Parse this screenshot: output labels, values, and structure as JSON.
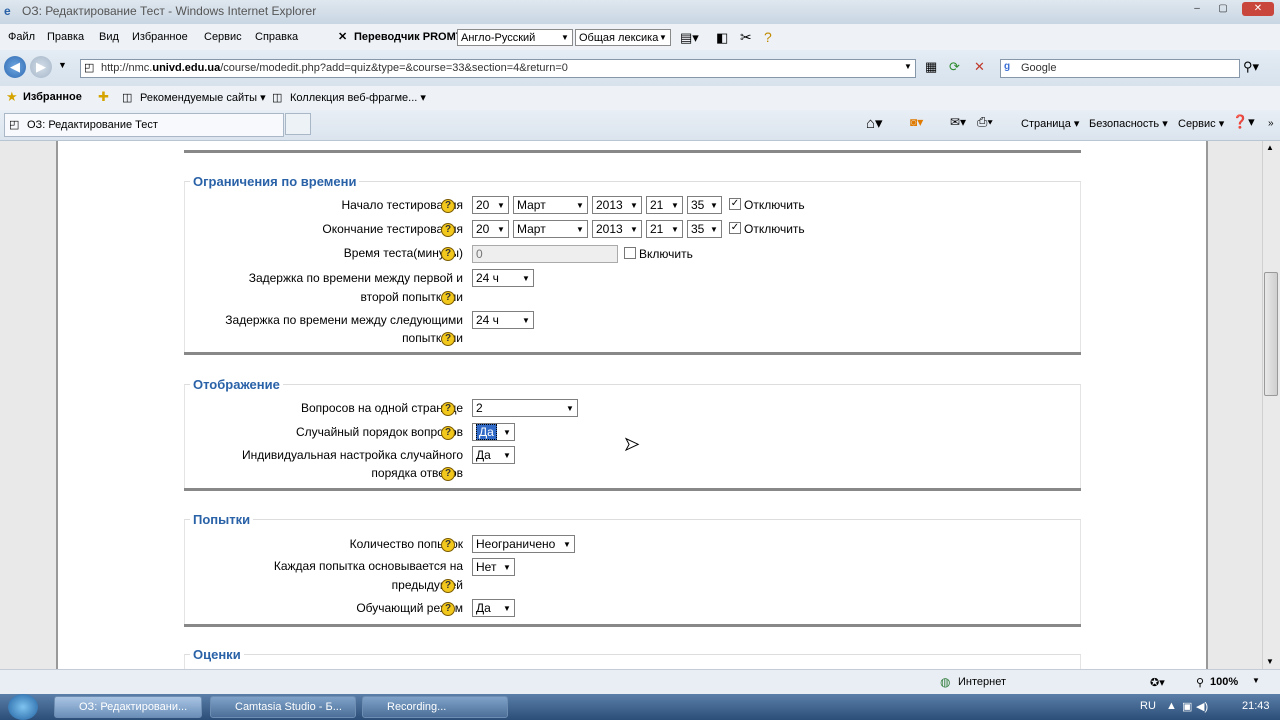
{
  "window": {
    "title": "ОЗ: Редактирование Тест - Windows Internet Explorer",
    "minimize": "‒",
    "maximize": "▢",
    "close": "✕"
  },
  "menubar": {
    "items": [
      "Файл",
      "Правка",
      "Вид",
      "Избранное",
      "Сервис",
      "Справка"
    ],
    "translator": "Переводчик PROMT",
    "direction": "Англо-Русский",
    "vocab": "Общая лексика"
  },
  "address": {
    "url_prefix": "http://nmc.",
    "url_domain": "univd.edu.ua",
    "url_path": "/course/modedit.php?add=quiz&type=&course=33&section=4&return=0",
    "search_placeholder": "Google"
  },
  "favorites": {
    "label": "Избранное",
    "items": [
      "Рекомендуемые сайты ▾",
      "Коллекция веб-фрагме... ▾"
    ]
  },
  "tab": {
    "title": "ОЗ: Редактирование Тест"
  },
  "commandbar": {
    "items": [
      "Страница ▾",
      "Безопасность ▾",
      "Сервис ▾"
    ]
  },
  "sections": {
    "time_limits": {
      "legend": "Ограничения по времени",
      "open_label": "Начало тестирования",
      "close_label": "Окончание тестирования",
      "open_date": {
        "day": "20",
        "month": "Март",
        "year": "2013",
        "hour": "21",
        "minute": "35"
      },
      "close_date": {
        "day": "20",
        "month": "Март",
        "year": "2013",
        "hour": "21",
        "minute": "35"
      },
      "disable_label": "Отключить",
      "time_label": "Время теста(минуты)",
      "time_value": "0",
      "enable_label": "Включить",
      "delay1_label_line1": "Задержка по времени между первой и",
      "delay1_label_line2": "второй попытками",
      "delay1_value": "24 ч",
      "delay2_label_line1": "Задержка по времени между следующими",
      "delay2_label_line2": "попытками",
      "delay2_value": "24 ч"
    },
    "display": {
      "legend": "Отображение",
      "perpage_label": "Вопросов на одной странице",
      "perpage_value": "2",
      "shuffle_q_label": "Случайный порядок вопросов",
      "shuffle_q_value": "Да",
      "shuffle_a_label_line1": "Индивидуальная настройка случайного",
      "shuffle_a_label_line2": "порядка ответов",
      "shuffle_a_value": "Да"
    },
    "attempts": {
      "legend": "Попытки",
      "count_label": "Количество попыток",
      "count_value": "Неограничено",
      "build_label_line1": "Каждая попытка основывается на",
      "build_label_line2": "предыдущей",
      "build_value": "Нет",
      "adaptive_label": "Обучающий режим",
      "adaptive_value": "Да"
    },
    "grades": {
      "legend": "Оценки"
    }
  },
  "statusbar": {
    "zone": "Интернет",
    "zoom": "100%"
  },
  "taskbar": {
    "tasks": [
      "ОЗ: Редактировани...",
      "Camtasia Studio - Б...",
      "Recording..."
    ],
    "lang": "RU",
    "clock": "21:43"
  }
}
